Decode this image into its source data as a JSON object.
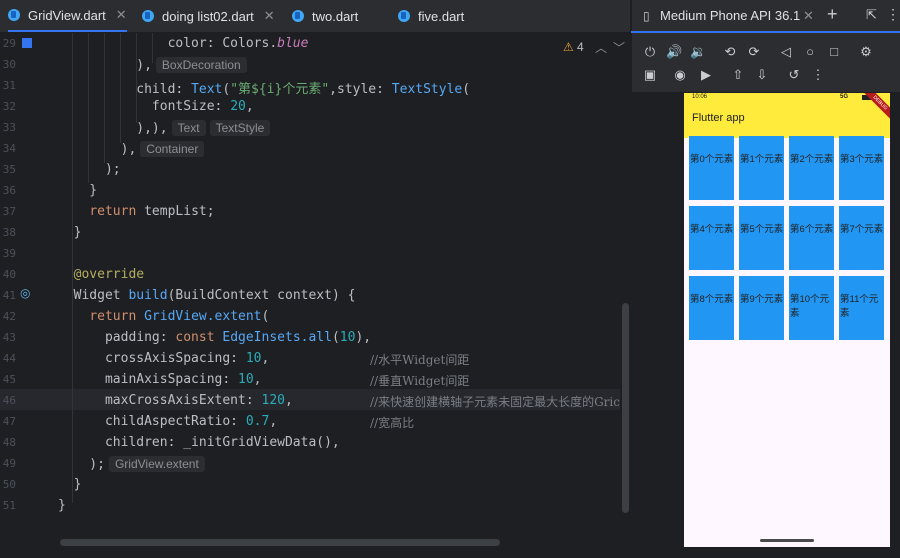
{
  "tabs": [
    {
      "label": "GridView.dart",
      "active": true,
      "closable": true
    },
    {
      "label": "doing list02.dart",
      "closable": true
    },
    {
      "label": "two.dart"
    },
    {
      "label": "five.dart"
    }
  ],
  "editor": {
    "warning_count": "4",
    "line_numbers": [
      "29",
      "30",
      "31",
      "32",
      "33",
      "34",
      "35",
      "36",
      "37",
      "38",
      "39",
      "40",
      "41",
      "42",
      "43",
      "44",
      "45",
      "46",
      "47",
      "48",
      "49",
      "50",
      "51"
    ],
    "hints": {
      "box_decoration": "BoxDecoration",
      "text": "Text",
      "text_style": "TextStyle",
      "container": "Container",
      "grid_view_extent": "GridView.extent"
    },
    "comments": {
      "cross": "//水平Widget间距",
      "main": "//垂直Widget间距",
      "max": "//来快速创建横轴子元素未固定最大长度的Gric",
      "ratio": "//宽高比"
    }
  },
  "emulator": {
    "title": "Medium Phone API 36.1",
    "status_time": "10:06",
    "status_right": "5G",
    "debug_label": "DEBUG",
    "app_title": "Flutter app",
    "grid_items": [
      "第0个元素",
      "第1个元素",
      "第2个元素",
      "第3个元素",
      "第4个元素",
      "第5个元素",
      "第6个元素",
      "第7个元素",
      "第8个元素",
      "第9个元素",
      "第10个元素",
      "第11个元素"
    ]
  },
  "colors": {
    "accent": "#3574f0",
    "app_bar": "#ffeb3b",
    "grid_item": "#2196f3",
    "editor_bg": "#1e1f22"
  }
}
